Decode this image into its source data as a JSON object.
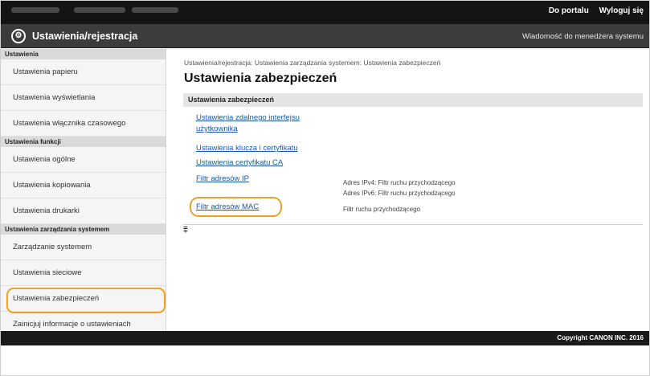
{
  "topbar": {
    "portal_link": "Do portalu",
    "logout_link": "Wyloguj się"
  },
  "titlebar": {
    "title": "Ustawienia/rejestracja",
    "message_link": "Wiadomość do menedżera systemu"
  },
  "sidebar": {
    "section1_header": "Ustawienia",
    "items1": [
      "Ustawienia papieru",
      "Ustawienia wyświetlania",
      "Ustawienia włącznika czasowego"
    ],
    "section2_header": "Ustawienia funkcji",
    "items2": [
      "Ustawienia ogólne",
      "Ustawienia kopiowania",
      "Ustawienia drukarki"
    ],
    "section3_header": "Ustawienia zarządzania systemem",
    "items3": [
      "Zarządzanie systemem",
      "Ustawienia sieciowe",
      "Ustawienia zabezpieczeń",
      "Zainicjuj informacje o ustawieniach"
    ]
  },
  "main": {
    "breadcrumb": "Ustawienia/rejestracja: Ustawienia zarządzania systemem: Ustawienia zabezpieczeń",
    "title": "Ustawienia zabezpieczeń",
    "section_title": "Ustawienia zabezpieczeń",
    "links": {
      "remote_ui_line1": "Ustawienia zdalnego interfejsu",
      "remote_ui_line2": "użytkownika",
      "key_cert": "Ustawienia klucza i certyfikatu",
      "ca_cert": "Ustawienia certyfikatu CA",
      "ip_filter": "Filtr adresów IP",
      "mac_filter": "Filtr adresów MAC"
    },
    "info": {
      "ipv4": "Adres IPv4: Filtr ruchu przychodzącego",
      "ipv6": "Adres IPv6: Filtr ruchu przychodzącego",
      "mac": "Filtr ruchu przychodzącego"
    },
    "top_icon": "⩱"
  },
  "footer": {
    "copyright": "Copyright CANON INC. 2016"
  },
  "colors": {
    "highlight": "#f0a124",
    "link": "#1b5aa8"
  }
}
